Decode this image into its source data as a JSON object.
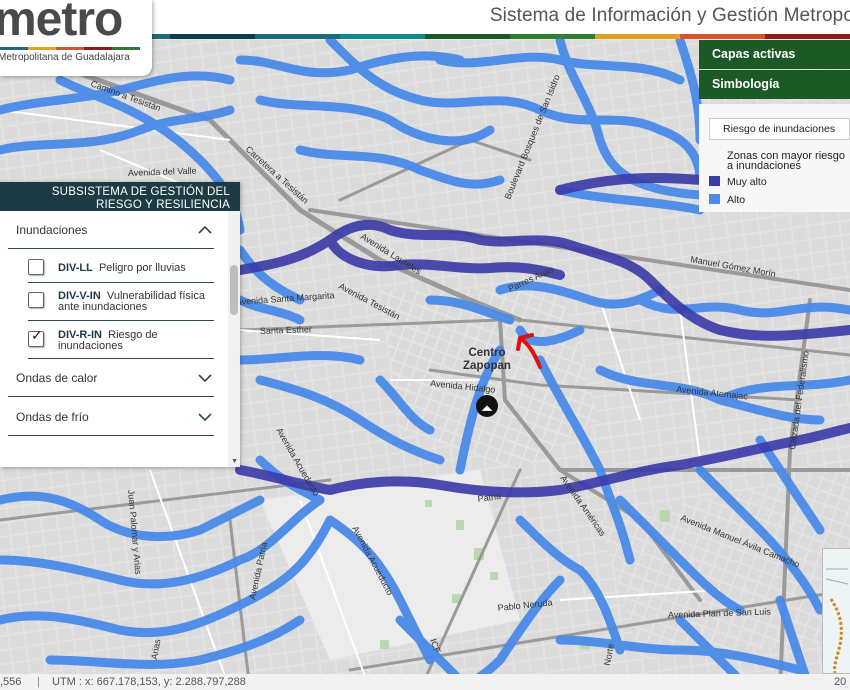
{
  "header": {
    "title": "Sistema de Información y Gestión Metropo",
    "strip_colors": [
      "#1c6a7a",
      "#1c6a7a",
      "#0d3b4a",
      "#1c6a7a",
      "#0f8a8a",
      "#1b5a26",
      "#2f7d33",
      "#e0a020",
      "#d5562a",
      "#8c1a1a"
    ]
  },
  "logo": {
    "word": "metro",
    "subtitle": "Metropolitana de Guadalajara",
    "underline_colors": [
      "#1c6a7a",
      "#e0a020",
      "#d5562a",
      "#8c1a1a",
      "#2f7d33"
    ]
  },
  "left_panel": {
    "title": "SUBSISTEMA DE GESTIÓN DEL RIESGO Y RESILIENCIA",
    "sections": [
      {
        "label": "Inundaciones",
        "expanded": true
      },
      {
        "label": "Ondas de calor",
        "expanded": false
      },
      {
        "label": "Ondas de frío",
        "expanded": false
      }
    ],
    "layers": [
      {
        "code": "DIV-LL",
        "label": "Peligro por lluvias",
        "checked": false
      },
      {
        "code": "DIV-V-IN",
        "label": "Vulnerabilidad física ante inundaciones",
        "checked": false
      },
      {
        "code": "DIV-R-IN",
        "label": "Riesgo de inundaciones",
        "checked": true
      }
    ]
  },
  "right_panel": {
    "tabs": [
      "Capas activas",
      "Simbología"
    ],
    "dropdown_value": "Riesgo de inundaciones",
    "legend_title_line1": "Zonas con mayor riesgo",
    "legend_title_line2": "a inundaciones",
    "legend_items": [
      {
        "label": "Muy alto",
        "color": "#3a3aa8"
      },
      {
        "label": "Alto",
        "color": "#4a8ae8"
      }
    ]
  },
  "map": {
    "center_label_line1": "Centro",
    "center_label_line2": "Zapopan",
    "street_labels": [
      "Camino a Tesistán",
      "Avenida del Valle",
      "Carretera a Tesistán",
      "Boulevard Bosques de San Isidro",
      "Avenida Laureles",
      "Avenida Tesistán",
      "Avenida Santa Margarita",
      "Parres Arias",
      "Manuel Gómez Morín",
      "Santa Esther",
      "Avenida Hidalgo",
      "Avenida Atemajac",
      "Calzada del Federalismo",
      "Avenida Acueducto",
      "Patria",
      "Avenida Américas",
      "Avenida Manuel Ávila Camacho",
      "Avenida Patria",
      "Juan Palomar y Arias",
      "Avenida Acueducto",
      "Pablo Neruda",
      "Avenida Plan de San Luis",
      "Arias",
      "Norte",
      "ICF"
    ]
  },
  "status_bar": {
    "left": ",556",
    "utm": "UTM : x: 667.178,153, y: 2.288.797,288",
    "right": "20"
  }
}
